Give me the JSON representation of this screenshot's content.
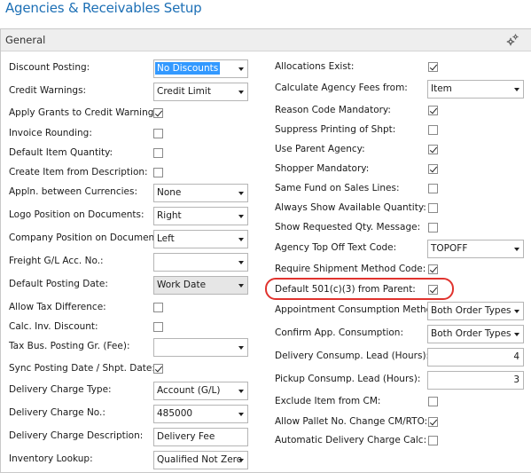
{
  "page": {
    "title": "Agencies & Receivables Setup"
  },
  "fasttab": {
    "title": "General"
  },
  "left_fields": [
    {
      "label": "Discount Posting:",
      "type": "select",
      "value": "No Discounts"
    },
    {
      "label": "Credit Warnings:",
      "type": "select",
      "value": "Credit Limit"
    },
    {
      "label": "Apply Grants to Credit Warning:",
      "type": "checkbox",
      "checked": true
    },
    {
      "label": "Invoice Rounding:",
      "type": "checkbox",
      "checked": false
    },
    {
      "label": "Default Item Quantity:",
      "type": "checkbox",
      "checked": false
    },
    {
      "label": "Create Item from Description:",
      "type": "checkbox",
      "checked": false
    },
    {
      "label": "Appln. between Currencies:",
      "type": "select",
      "value": "None"
    },
    {
      "label": "Logo Position on Documents:",
      "type": "select",
      "value": "Right"
    },
    {
      "label": "Company Position on Documents:",
      "type": "select",
      "value": "Left"
    },
    {
      "label": "Freight G/L Acc. No.:",
      "type": "select",
      "value": ""
    },
    {
      "label": "Default Posting Date:",
      "type": "select",
      "value": "Work Date"
    },
    {
      "label": "Allow Tax Difference:",
      "type": "checkbox",
      "checked": false
    },
    {
      "label": "Calc. Inv. Discount:",
      "type": "checkbox",
      "checked": false
    },
    {
      "label": "Tax Bus. Posting Gr. (Fee):",
      "type": "select",
      "value": ""
    },
    {
      "label": "Sync Posting Date / Shpt. Date:",
      "type": "checkbox",
      "checked": true
    },
    {
      "label": "Delivery Charge Type:",
      "type": "select",
      "value": "Account (G/L)"
    },
    {
      "label": "Delivery Charge No.:",
      "type": "select",
      "value": "485000"
    },
    {
      "label": "Delivery Charge Description:",
      "type": "text",
      "value": "Delivery Fee"
    },
    {
      "label": "Inventory Lookup:",
      "type": "select",
      "value": "Qualified Not Zero"
    }
  ],
  "right_fields": [
    {
      "label": "Allocations Exist:",
      "type": "checkbox",
      "checked": true
    },
    {
      "label": "Calculate Agency Fees from:",
      "type": "select",
      "value": "Item"
    },
    {
      "label": "Reason Code Mandatory:",
      "type": "checkbox",
      "checked": true
    },
    {
      "label": "Suppress Printing of Shpt:",
      "type": "checkbox",
      "checked": false
    },
    {
      "label": "Use Parent Agency:",
      "type": "checkbox",
      "checked": true
    },
    {
      "label": "Shopper Mandatory:",
      "type": "checkbox",
      "checked": true
    },
    {
      "label": "Same Fund on Sales Lines:",
      "type": "checkbox",
      "checked": false
    },
    {
      "label": "Always Show Available Quantity:",
      "type": "checkbox",
      "checked": false
    },
    {
      "label": "Show Requested Qty. Message:",
      "type": "checkbox",
      "checked": false
    },
    {
      "label": "Agency Top Off Text Code:",
      "type": "select",
      "value": "TOPOFF"
    },
    {
      "label": "Require Shipment Method Code:",
      "type": "checkbox",
      "checked": true
    },
    {
      "label": "Default 501(c)(3) from Parent:",
      "type": "checkbox",
      "checked": true
    },
    {
      "label": "Appointment Consumption Method:",
      "type": "select",
      "value": "Both Order Types"
    },
    {
      "label": "Confirm App. Consumption:",
      "type": "select",
      "value": "Both Order Types"
    },
    {
      "label": "Delivery Consump. Lead (Hours):",
      "type": "number",
      "value": "4"
    },
    {
      "label": "Pickup Consump. Lead (Hours):",
      "type": "number",
      "value": "3"
    },
    {
      "label": "Exclude Item from CM:",
      "type": "checkbox",
      "checked": false
    },
    {
      "label": "Allow Pallet No. Change CM/RTO:",
      "type": "checkbox",
      "checked": true
    },
    {
      "label": "Automatic Delivery Charge Calc:",
      "type": "checkbox",
      "checked": false
    }
  ],
  "colors": {
    "title_blue": "#1c6fb5",
    "highlight_oval": "#e0332e",
    "selection_blue": "#3399ff"
  },
  "icons": {
    "fasttab_action": "gear-icon"
  }
}
